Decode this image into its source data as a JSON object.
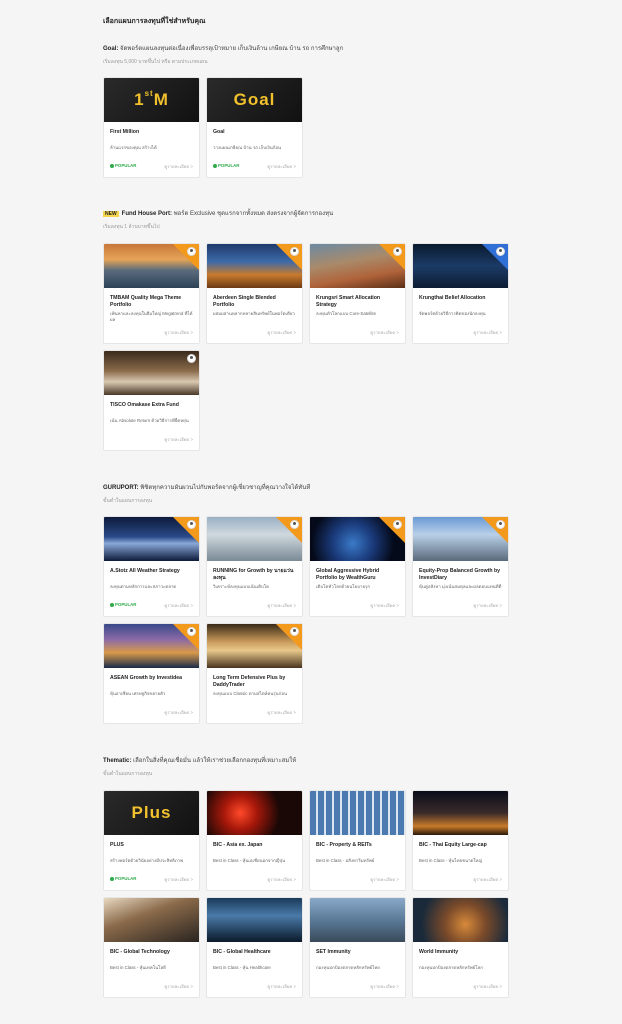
{
  "page_title": "เลือกแผนการลงทุนที่ใช่สำหรับคุณ",
  "sections": [
    {
      "title": "Goal:",
      "desc": "จัดพอร์ตแผนลงทุนต่อเนื่องเพื่อบรรลุเป้าหมาย เก็บเงินล้าน เกษียณ บ้าน รถ การศึกษาลูก",
      "sub": "เริ่มลงทุน 5,000 บาทขึ้นไป หรือ ตามประเภทแผน",
      "cards": [
        {
          "title": "First Million",
          "desc": "ล้านแรกของคุณ สร้างได้",
          "big": "1stM",
          "popular": "POPULAR",
          "more": "ดูรายละเอียด >"
        },
        {
          "title": "Goal",
          "desc": "วางแผนเกษียณ บ้าน รถ เก็บเงินก้อน",
          "big": "Goal",
          "popular": "POPULAR",
          "more": "ดูรายละเอียด >"
        }
      ]
    },
    {
      "badge": "NEW",
      "title": "Fund House Port:",
      "desc": "พอร์ต Exclusive ชุดแรกจากทั้งหมด ส่งตรงจากผู้จัดการกองทุน",
      "sub": "เริ่มลงทุน 1 ล้านบาทขึ้นไป",
      "cards": [
        {
          "title": "TMBAM Quality Mega Theme Portfolio",
          "desc": "เฟ้นหาและลงทุนในธีมใหญ่ Megatrend ที่ได้ผล",
          "more": "ดูรายละเอียด >"
        },
        {
          "title": "Aberdeen Single Blended Portfolio",
          "desc": "ผสมผสานหลากหลายสินทรัพย์ในพอร์ตเดียว",
          "more": "ดูรายละเอียด >"
        },
        {
          "title": "Krungsri Smart Allocation Strategy",
          "desc": "ลงทุนทั่วโลกแบบ Core-Satellite",
          "more": "ดูรายละเอียด >"
        },
        {
          "title": "Krungthai Belief Allocation",
          "desc": "จัดพอร์ตด้วยวิธีการคิดของนักลงทุน",
          "more": "ดูรายละเอียด >"
        },
        {
          "title": "TISCO Omakase Extra Fund",
          "desc": "เน้น Absolute Return ด้วยวิธีการที่ยืดหยุ่น",
          "more": "ดูรายละเอียด >"
        }
      ]
    },
    {
      "title": "GURUPORT:",
      "desc": "พิชิตทุกความผันผวนไปกับพอร์ตจากผู้เชี่ยวชาญที่คุณวางใจได้ทันที",
      "sub": "ขั้นต่ำในแผนการลงทุน",
      "cards": [
        {
          "title": "A.Stotz All Weather Strategy",
          "desc": "ลงทุนตามหลักการและสภาวะตลาด",
          "popular": "POPULAR",
          "more": "ดูรายละเอียด >"
        },
        {
          "title": "RUNNING for Growth by นายแว่นลงทุน",
          "desc": "วิเคราะห์ลงทุนแบบเน้นเติบโต",
          "more": "ดูรายละเอียด >"
        },
        {
          "title": "Global Aggressive Hybrid Portfolio by WealthGuru",
          "desc": "เติบโตทั่วโลกด้วยนโยบายรุก",
          "more": "ดูรายละเอียด >"
        },
        {
          "title": "Equity-Prop Balanced Growth by InvestDiary",
          "desc": "หุ้นคู่อสังหา มุ่งเน้นสมดุลและผลตอบแทนที่ดี",
          "more": "ดูรายละเอียด >"
        },
        {
          "title": "ASEAN Growth by Investidea",
          "desc": "หุ้นอาเซียน เศรษฐกิจขยายตัว",
          "more": "ดูรายละเอียด >"
        },
        {
          "title": "Long Term Defensive Plus by DaddyTrader",
          "desc": "ลงทุนแบบ Classic ตามสไตล์คนรุ่นก่อน",
          "more": "ดูรายละเอียด >"
        }
      ]
    },
    {
      "title": "Thematic:",
      "desc": "เลือกในสิ่งที่คุณเชื่อมั่น แล้วให้เราช่วยเลือกกองทุนที่เหมาะสมให้",
      "sub": "ขั้นต่ำในแผนการลงทุน",
      "cards": [
        {
          "title": "PLUS",
          "desc": "สร้างพอร์ตด้วยวินัยอย่างมีประสิทธิภาพ",
          "big": "Plus",
          "popular": "POPULAR",
          "more": "ดูรายละเอียด >"
        },
        {
          "title": "BIC - Asia ex. Japan",
          "desc": "Best in Class - หุ้นเอเชียนอกจากญี่ปุ่น",
          "more": "ดูรายละเอียด >"
        },
        {
          "title": "BIC - Property & REITs",
          "desc": "Best in Class - อสังหาริมทรัพย์",
          "more": "ดูรายละเอียด >"
        },
        {
          "title": "BIC - Thai Equity Large-cap",
          "desc": "Best in Class - หุ้นไทยขนาดใหญ่",
          "more": "ดูรายละเอียด >"
        },
        {
          "title": "BIC - Global Technology",
          "desc": "Best in Class - หุ้นเทคโนโลยี",
          "more": "ดูรายละเอียด >"
        },
        {
          "title": "BIC - Global Healthcare",
          "desc": "Best in Class - หุ้น Healthcare",
          "more": "ดูรายละเอียด >"
        },
        {
          "title": "SET Immunity",
          "desc": "กองทุนปกป้องตลาดหลักทรัพย์ไทย",
          "more": "ดูรายละเอียด >"
        },
        {
          "title": "World Immunity",
          "desc": "กองทุนปกป้องตลาดหลักทรัพย์โลก",
          "more": "ดูรายละเอียด >"
        }
      ]
    }
  ],
  "colors": {
    "accent_orange": "#f39a1c",
    "popular_green": "#2eaa4a",
    "badge_yellow": "#f5d64e",
    "big_text_gold": "#f2c12e"
  }
}
